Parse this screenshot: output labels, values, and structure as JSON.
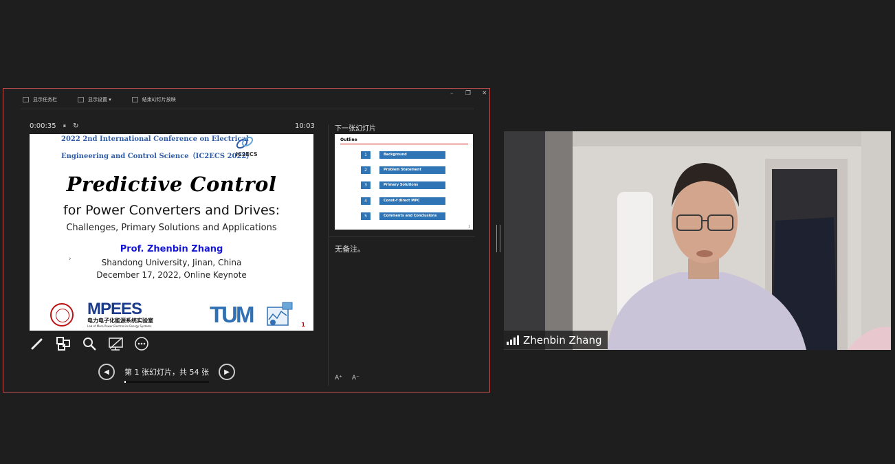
{
  "toolbar": {
    "taskbar_label": "显示任务栏",
    "display_settings_label": "显示设置 ▾",
    "end_show_label": "结束幻灯片放映"
  },
  "window_controls": {
    "minimize": "–",
    "restore": "❐",
    "close": "✕"
  },
  "presenter": {
    "elapsed": "0:00:35",
    "clock": "10:03",
    "next_slide_label": "下一张幻灯片",
    "notes_text": "无备注。",
    "slide_counter": "第 1 张幻灯片，共 54 张",
    "slide_progress_fraction": 0.0185
  },
  "current_slide": {
    "conf_line1": "2022 2nd International Conference on Electrical",
    "conf_line2": "Engineering and Control Science（IC2ECS 2022）",
    "conf_logo_text": "IC2ECS",
    "title": "Predictive Control",
    "subtitle": "for Power Converters and Drives:",
    "subtitle2": "Challenges, Primary Solutions and Applications",
    "author": "Prof. Zhenbin Zhang",
    "affiliation": "Shandong University, Jinan, China",
    "date_venue": "December 17, 2022, Online Keynote",
    "logo_mpees": "MPEES",
    "logo_mpees_cn": "电力电子化能源系统实验室",
    "logo_mpees_en": "Lab of More Power Electronics Energy Systems",
    "logo_tum": "TUM",
    "page_number": "1"
  },
  "next_slide": {
    "title": "Outline",
    "items": [
      {
        "num": "1",
        "label": "Background"
      },
      {
        "num": "2",
        "label": "Problem Statement"
      },
      {
        "num": "3",
        "label": "Primary Solutions"
      },
      {
        "num": "4",
        "label": "Const-f direct MPC"
      },
      {
        "num": "5",
        "label": "Comments and Conclusions"
      }
    ],
    "page_number": "2"
  },
  "font_buttons": {
    "increase": "A⁺",
    "decrease": "A⁻"
  },
  "video": {
    "participant_name": "Zhenbin Zhang"
  },
  "colors": {
    "accent_border": "#c0504d",
    "outline_blue": "#2f75b5",
    "author_blue": "#1515d8"
  }
}
